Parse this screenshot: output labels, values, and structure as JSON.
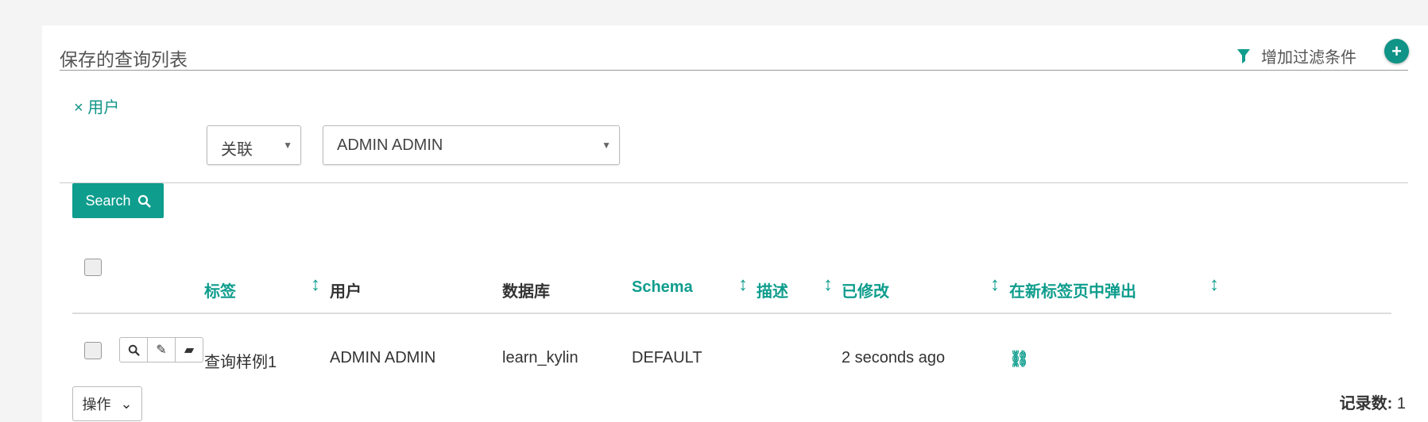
{
  "header": {
    "title": "保存的查询列表",
    "add_filter_label": "增加过滤条件",
    "add_icon": "plus-icon"
  },
  "filter": {
    "remove_label": "× 用户",
    "relation": {
      "value": "关联"
    },
    "user": {
      "value": "ADMIN ADMIN"
    }
  },
  "search": {
    "label": "Search"
  },
  "table": {
    "headers": [
      "标签",
      "用户",
      "数据库",
      "Schema",
      "描述",
      "已修改",
      "在新标签页中弹出"
    ],
    "rows": [
      {
        "tag": "查询样例1",
        "user": "ADMIN ADMIN",
        "database": "learn_kylin",
        "schema": "DEFAULT",
        "desc": "",
        "modified": "2 seconds ago"
      }
    ]
  },
  "footer": {
    "ops_label": "操作",
    "count_label": "记录数:",
    "count_value": "1"
  },
  "colors": {
    "accent": "#0f9d8d",
    "background": "#f4f4f4"
  }
}
